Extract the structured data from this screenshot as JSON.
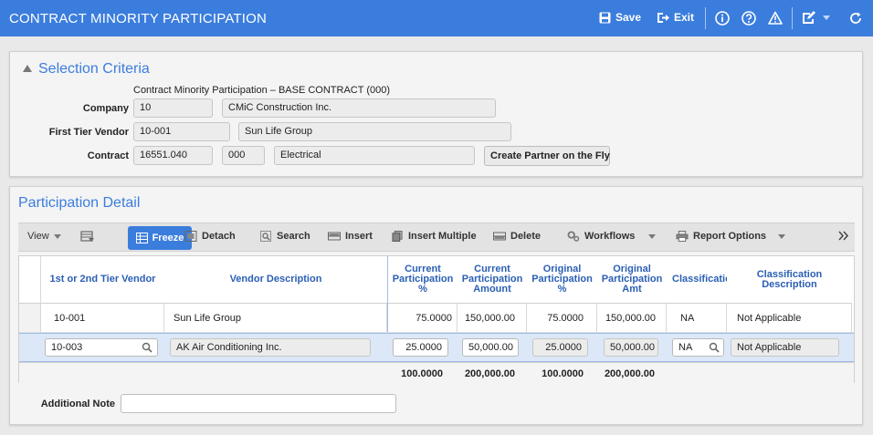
{
  "header": {
    "title": "CONTRACT MINORITY PARTICIPATION",
    "save_label": "Save",
    "exit_label": "Exit",
    "bg_color": "#3b7ddd"
  },
  "selection": {
    "heading": "Selection Criteria",
    "subtitle": "Contract Minority Participation – BASE CONTRACT (000)",
    "company_label": "Company",
    "company_code": "10",
    "company_name": "CMiC Construction Inc.",
    "vendor_label": "First Tier Vendor",
    "vendor_code": "10-001",
    "vendor_name": "Sun Life Group",
    "contract_label": "Contract",
    "contract_code": "16551.040",
    "contract_sub": "000",
    "contract_desc": "Electrical",
    "create_partner_label": "Create Partner on the Fly"
  },
  "detail": {
    "heading": "Participation Detail",
    "toolbar": {
      "view": "View",
      "freeze": "Freeze",
      "detach": "Detach",
      "search": "Search",
      "insert": "Insert",
      "insert_multiple": "Insert Multiple",
      "delete": "Delete",
      "workflows": "Workflows",
      "report_options": "Report Options"
    },
    "columns": {
      "vendor": "1st or 2nd Tier Vendor",
      "desc": "Vendor Description",
      "cur_pct": "Current Participation %",
      "cur_amt": "Current Participation Amount",
      "orig_pct": "Original Participation %",
      "orig_amt": "Original Participation Amt",
      "class_code": "Classification Code",
      "class_desc": "Classification Description"
    },
    "rows": [
      {
        "vendor": "10-001",
        "desc": "Sun Life Group",
        "cur_pct": "75.0000",
        "cur_amt": "150,000.00",
        "orig_pct": "75.0000",
        "orig_amt": "150,000.00",
        "class_code": "NA",
        "class_desc": "Not Applicable"
      },
      {
        "vendor": "10-003",
        "desc": "AK Air Conditioning Inc.",
        "cur_pct": "25.0000",
        "cur_amt": "50,000.00",
        "orig_pct": "25.0000",
        "orig_amt": "50,000.00",
        "class_code": "NA",
        "class_desc": "Not Applicable"
      }
    ],
    "totals": {
      "cur_pct": "100.0000",
      "cur_amt": "200,000.00",
      "orig_pct": "100.0000",
      "orig_amt": "200,000.00"
    },
    "note_label": "Additional Note",
    "note_value": ""
  }
}
